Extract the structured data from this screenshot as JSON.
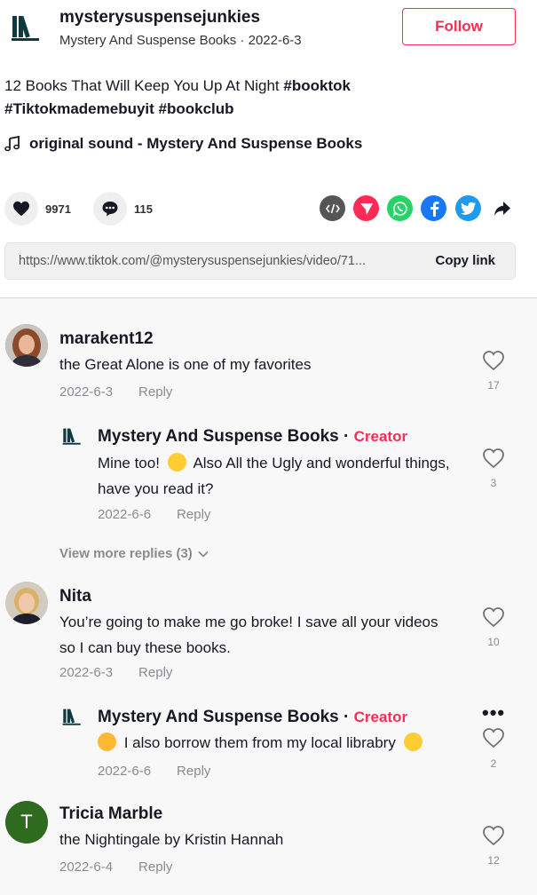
{
  "post": {
    "author_handle": "mysterysuspensejunkies",
    "subtitle": "Mystery And Suspense Books · 2022-6-3",
    "follow_label": "Follow",
    "desc_text": "12 Books That Will Keep You Up At Night ",
    "tags": [
      "#booktok",
      "#Tiktokmademebuyit",
      "#bookclub"
    ],
    "music": "original sound - Mystery And Suspense Books",
    "likes": "9971",
    "comments_count": "115",
    "url": "https://www.tiktok.com/@mysterysuspensejunkies/video/71...",
    "copy_label": "Copy link"
  },
  "colors": {
    "accent": "#fe2c55",
    "muted": "#8a8b91",
    "whatsapp": "#25d366",
    "facebook": "#1877f2",
    "twitter": "#1d9bf0",
    "embed": "#555555"
  },
  "comments": [
    {
      "name": "marakent12",
      "text": "the Great Alone is one of my favorites",
      "date": "2022-6-3",
      "reply": "Reply",
      "likes": "17",
      "reply_item": {
        "name": "Mystery And Suspense Books",
        "sep": "·",
        "creator": "Creator",
        "text_a": "Mine too! ",
        "text_b": " Also All the Ugly and wonderful things, have you read it?",
        "date": "2022-6-6",
        "reply": "Reply",
        "likes": "3"
      },
      "view_more": "View more replies (3)"
    },
    {
      "name": "Nita",
      "text": "You’re going to make me go broke! I save all your videos so I can buy these books.",
      "date": "2022-6-3",
      "reply": "Reply",
      "likes": "10",
      "reply_item": {
        "name": "Mystery And Suspense Books",
        "sep": "·",
        "creator": "Creator",
        "text": " I also borrow them from my local librabry ",
        "date": "2022-6-6",
        "reply": "Reply",
        "likes": "2",
        "more": "•••"
      }
    },
    {
      "name": "Tricia Marble",
      "avatar_letter": "T",
      "text": "the Nightingale by Kristin Hannah",
      "date": "2022-6-4",
      "reply": "Reply",
      "likes": "12"
    }
  ]
}
